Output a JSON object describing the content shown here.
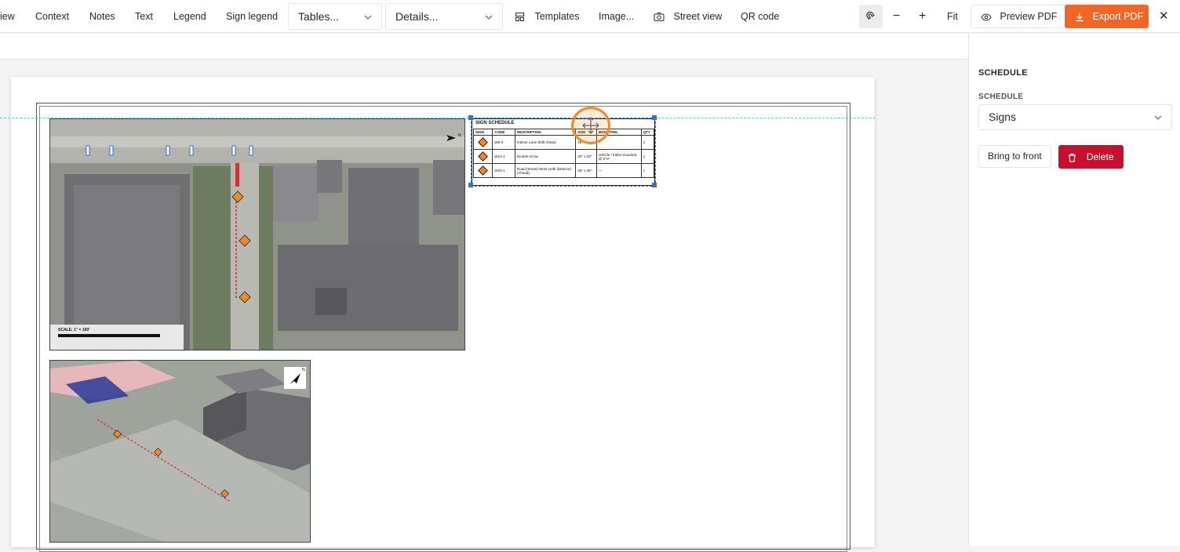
{
  "toolbar": {
    "items": [
      {
        "label": "iew"
      },
      {
        "label": "Context"
      },
      {
        "label": "Notes"
      },
      {
        "label": "Text"
      },
      {
        "label": "Legend"
      },
      {
        "label": "Sign legend"
      }
    ],
    "tables_select": "Tables...",
    "details_select": "Details...",
    "templates_label": "Templates",
    "image_label": "Image...",
    "street_view_label": "Street view",
    "qr_code_label": "QR code",
    "zoom_out": "−",
    "zoom_in": "+",
    "fit_label": "Fit",
    "preview_label": "Preview PDF",
    "export_label": "Export PDF",
    "close": "✕",
    "accent_color": "#f26522"
  },
  "panel": {
    "title": "SCHEDULE",
    "field_label": "SCHEDULE",
    "field_value": "Signs",
    "bring_to_front": "Bring to front",
    "delete": "Delete",
    "delete_color": "#c8102e"
  },
  "sheet": {
    "scale_label": "SCALE: 1\" = 100'",
    "north_label": "N",
    "schedule": {
      "title": "SIGN SCHEDULE",
      "headers": [
        "SIGN",
        "CODE",
        "DESCRIPTION",
        "SIZE",
        "MOUNTING",
        "QTY"
      ],
      "rows": [
        {
          "code": "W9-3",
          "description": "Interior Lane Shift Ahead",
          "size": "48\"",
          "mounting": "",
          "qty": "1"
        },
        {
          "code": "W12-1",
          "description": "Double Arrow",
          "size": "30\" x 30\"",
          "mounting": "Vehicle / trailer-mounted @ 5'-0\"",
          "qty": "1"
        },
        {
          "code": "W20-1",
          "description": "Road (Street) Work (with distance) (Ahead)",
          "size": "48\" x 48\"",
          "mounting": "—",
          "qty": "1"
        }
      ]
    }
  }
}
